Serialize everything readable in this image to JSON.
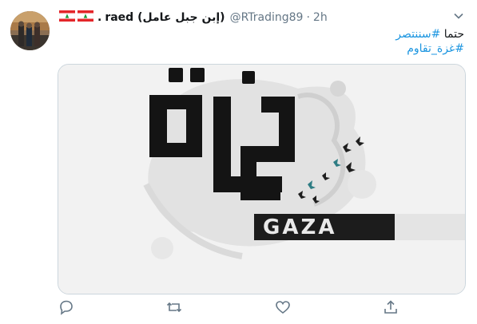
{
  "tweet": {
    "flags": [
      "lebanon-flag",
      "lebanon-flag"
    ],
    "name_separator": ".",
    "display_name": "raed (إبن جبل عامل)",
    "handle": "@RTrading89",
    "separator": "·",
    "time": "2h",
    "text_line1_prefix": "حتما ",
    "text_line1_hashtag": "#سننتصر",
    "text_line2_hashtag": "#غزة_تقاوم"
  },
  "media": {
    "arabic_title": "غزة",
    "english_title": "GAZA"
  },
  "actions": [
    {
      "icon": "reply-icon"
    },
    {
      "icon": "retweet-icon"
    },
    {
      "icon": "like-icon"
    },
    {
      "icon": "share-icon"
    }
  ],
  "colors": {
    "link": "#1b95e0",
    "secondary_text": "#657786",
    "border": "#ccd6dd"
  }
}
